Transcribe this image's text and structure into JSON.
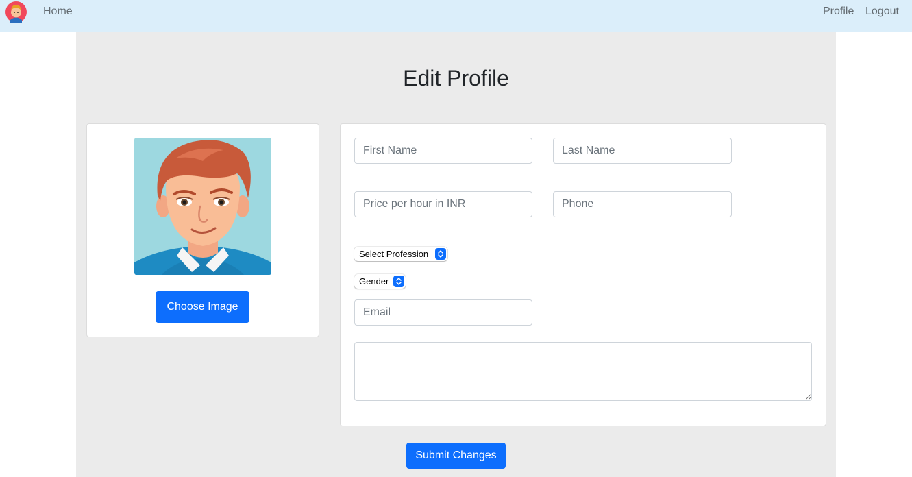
{
  "navbar": {
    "logo_icon": "avatar-logo-icon",
    "home_label": "Home",
    "profile_label": "Profile",
    "logout_label": "Logout",
    "background": "#dbeefa"
  },
  "page": {
    "title": "Edit Profile"
  },
  "avatar_card": {
    "avatar_icon": "cartoon-man-avatar",
    "choose_image_label": "Choose Image"
  },
  "form": {
    "first_name": {
      "value": "",
      "placeholder": "First Name"
    },
    "last_name": {
      "value": "",
      "placeholder": "Last Name"
    },
    "price": {
      "value": "",
      "placeholder": "Price per hour in INR"
    },
    "phone": {
      "value": "",
      "placeholder": "Phone"
    },
    "profession_select": {
      "selected": "Select Profession"
    },
    "gender_select": {
      "selected": "Gender"
    },
    "email": {
      "value": "",
      "placeholder": "Email"
    },
    "bio": {
      "value": ""
    },
    "submit_label": "Submit Changes"
  },
  "colors": {
    "primary": "#0d6efd",
    "page_background": "#ebebeb",
    "card_background": "#ffffff"
  }
}
